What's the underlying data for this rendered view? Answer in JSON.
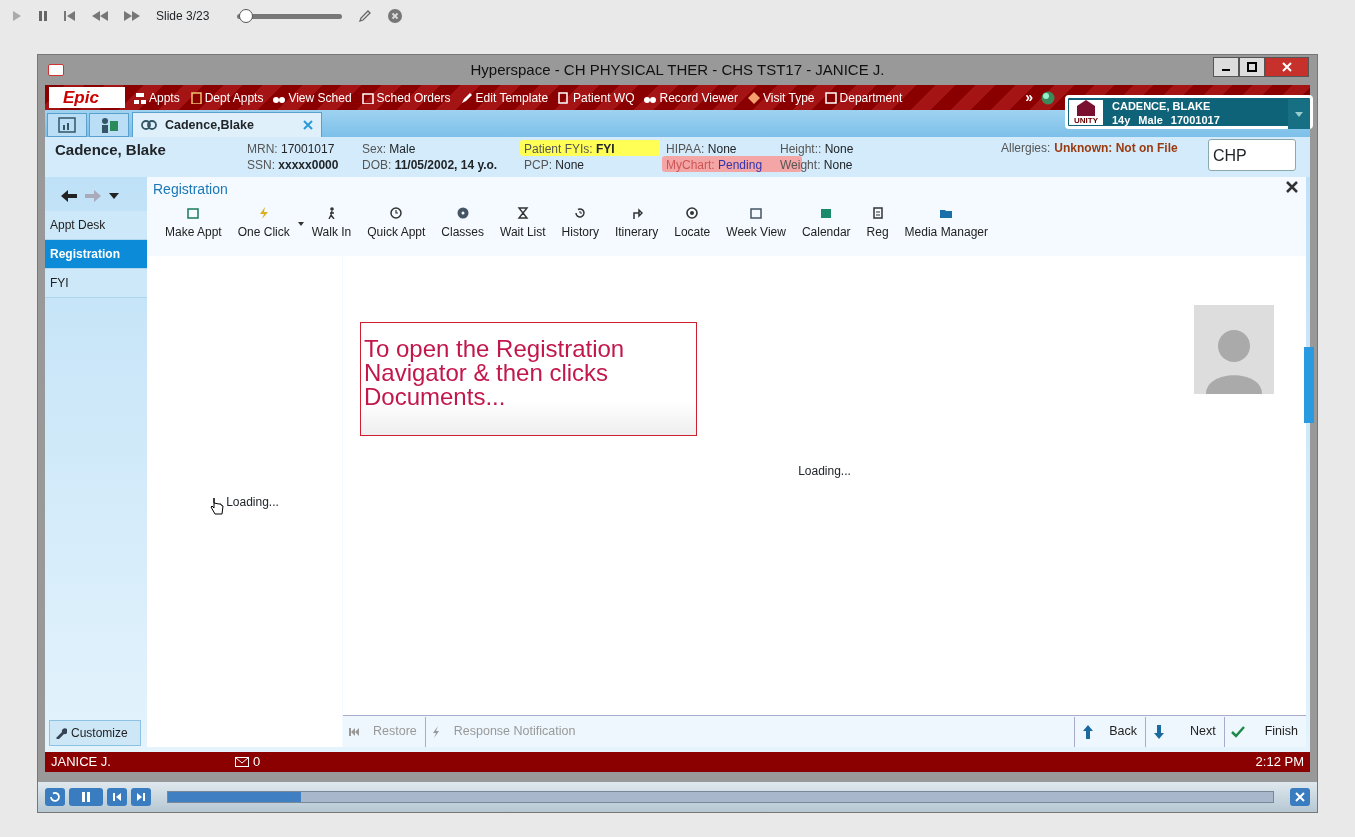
{
  "player": {
    "slide_label": "Slide 3/23",
    "level": 0.08
  },
  "window": {
    "title": "Hyperspace - CH PHYSICAL THER - CHS TST17 - JANICE J."
  },
  "menu": {
    "logo": "Epic",
    "items": [
      {
        "label": "Appts"
      },
      {
        "label": "Dept Appts"
      },
      {
        "label": "View Sched"
      },
      {
        "label": "Sched Orders"
      },
      {
        "label": "Edit Template"
      },
      {
        "label": "Patient WQ"
      },
      {
        "label": "Record Viewer"
      },
      {
        "label": "Visit Type"
      },
      {
        "label": "Department"
      }
    ],
    "more": "»"
  },
  "patient_card": {
    "name": "CADENCE, BLAKE",
    "age": "14y",
    "sex": "Male",
    "mrn": "17001017",
    "logo": "UNITY"
  },
  "tabs": [
    {
      "kind": "icon",
      "selected": false
    },
    {
      "kind": "icon",
      "selected": false
    },
    {
      "kind": "patient",
      "label": "Cadence,Blake",
      "selected": true
    }
  ],
  "header": {
    "name": "Cadence, Blake",
    "fields": [
      {
        "label": "MRN:",
        "value": "17001017",
        "emphasis": false
      },
      {
        "label": "Sex:",
        "value": "Male",
        "emphasis": false
      },
      {
        "label": "Patient FYIs:",
        "value": "FYI",
        "emphasis": true,
        "color": "#ffff55"
      },
      {
        "label": "HIPAA:",
        "value": "None",
        "emphasis": false
      },
      {
        "label": "Height::",
        "value": "None",
        "emphasis": false
      },
      {
        "label": "SSN:",
        "value": "xxxxx0000",
        "emphasis": true
      },
      {
        "label": "DOB:",
        "value": "11/05/2002, 14 y.o.",
        "emphasis": true
      },
      {
        "label": "PCP:",
        "value": "None",
        "emphasis": false
      },
      {
        "label": "MyChart:",
        "value": "Pending",
        "emphasis": false,
        "color": "#f4a6a6"
      },
      {
        "label": "Weight:",
        "value": "None",
        "emphasis": false
      }
    ],
    "allergies_label": "Allergies:",
    "allergies_value": "Unknown: Not on File",
    "department": "CHP"
  },
  "nav": {
    "items": [
      {
        "label": "Appt Desk",
        "selected": false
      },
      {
        "label": "Registration",
        "selected": true
      },
      {
        "label": "FYI",
        "selected": false
      }
    ],
    "customize": "Customize"
  },
  "activity": {
    "title": "Registration",
    "toolbar": [
      {
        "label": "Make Appt"
      },
      {
        "label": "One Click"
      },
      {
        "label": "Walk In"
      },
      {
        "label": "Quick Appt"
      },
      {
        "label": "Classes"
      },
      {
        "label": "Wait List"
      },
      {
        "label": "History"
      },
      {
        "label": "Itinerary"
      },
      {
        "label": "Locate"
      },
      {
        "label": "Week View"
      },
      {
        "label": "Calendar"
      },
      {
        "label": "Reg"
      },
      {
        "label": "Media Manager"
      }
    ],
    "left_loading": "Loading...",
    "callout": "To open the Registration Navigator & then clicks Documents...",
    "center_loading": "Loading...",
    "bottom": {
      "restore": "Restore",
      "response": "Response Notification",
      "back": "Back",
      "next": "Next",
      "finish": "Finish"
    }
  },
  "status": {
    "user": "JANICE J.",
    "mail_count": "0",
    "time": "2:12 PM"
  },
  "progress": {
    "level": 0.12
  }
}
